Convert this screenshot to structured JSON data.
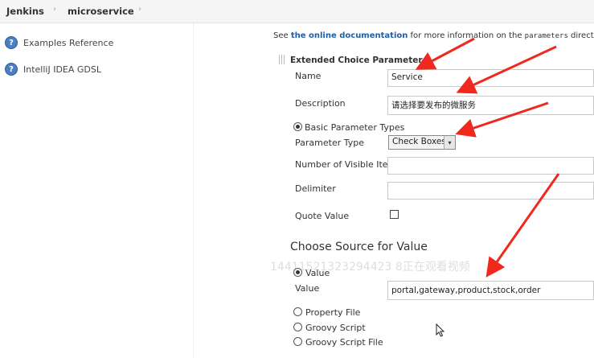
{
  "breadcrumb": {
    "items": [
      "Jenkins",
      "microservice"
    ],
    "separator": "›"
  },
  "sidebar": {
    "items": [
      {
        "label": "Examples Reference",
        "icon": "help-icon"
      },
      {
        "label": "IntelliJ IDEA GDSL",
        "icon": "help-icon"
      }
    ]
  },
  "info": {
    "prefix": "See ",
    "link": "the online documentation",
    "middle": " for more information on the ",
    "code": "parameters",
    "suffix": " directive."
  },
  "section": {
    "title": "Extended Choice Parameter",
    "name_label": "Name",
    "name_value": "Service",
    "description_label": "Description",
    "description_value": "请选择要发布的微服务",
    "basic_types_label": "Basic Parameter Types",
    "parameter_type_label": "Parameter Type",
    "parameter_type_value": "Check Boxes",
    "visible_items_label": "Number of Visible Items",
    "delimiter_label": "Delimiter",
    "quote_value_label": "Quote Value"
  },
  "source": {
    "title": "Choose Source for Value",
    "value_radio_label": "Value",
    "value_label": "Value",
    "value_text": "portal,gateway,product,stock,order",
    "property_file_label": "Property File",
    "groovy_script_label": "Groovy Script",
    "groovy_script_file_label": "Groovy Script File"
  },
  "watermark": "14411521323294423 8正在观看视频",
  "colors": {
    "annotation_arrow": "#f0281e",
    "link": "#1f5fa0",
    "help_icon": "#4d7fc0"
  }
}
